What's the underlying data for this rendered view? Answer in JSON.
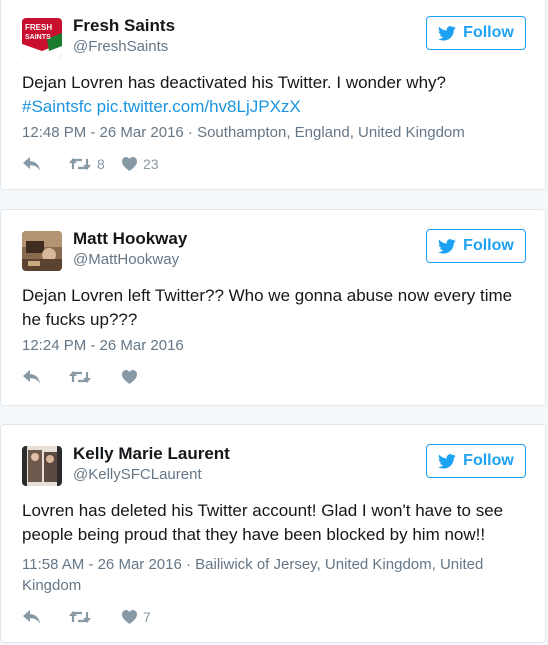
{
  "colors": {
    "accent": "#1da1f2",
    "link": "#1b95e0",
    "text": "#14171a",
    "muted": "#657786",
    "action": "#8899a6",
    "border": "#e1e8ed",
    "background": "#f5f8fa"
  },
  "tweets": [
    {
      "name": "Fresh Saints",
      "handle": "@FreshSaints",
      "avatar_text": "FRESH SAINTS",
      "follow_label": "Follow",
      "text": "Dejan Lovren has deactivated his Twitter. I wonder why?",
      "hashtag": "#Saintsfc",
      "link": "pic.twitter.com/hv8LjJPXzX",
      "meta": "12:48 PM - 26 Mar 2016 · Southampton, England, United Kingdom",
      "retweets": "8",
      "likes": "23",
      "icons": [
        "reply-icon",
        "retweet-icon",
        "heart-icon",
        "twitter-bird-icon"
      ]
    },
    {
      "name": "Matt Hookway",
      "handle": "@MattHookway",
      "follow_label": "Follow",
      "text": "Dejan Lovren left Twitter?? Who we gonna abuse now every time he fucks up???",
      "meta": "12:24 PM - 26 Mar 2016",
      "retweets": "",
      "likes": "",
      "icons": [
        "reply-icon",
        "retweet-icon",
        "heart-icon",
        "twitter-bird-icon"
      ]
    },
    {
      "name": "Kelly Marie Laurent",
      "handle": "@KellySFCLaurent",
      "follow_label": "Follow",
      "text": "Lovren has deleted his Twitter account! Glad I won't have to see people being proud that they have been blocked by him now!!",
      "meta": "11:58 AM - 26 Mar 2016 · Bailiwick of Jersey, United Kingdom, United Kingdom",
      "retweets": "",
      "likes": "7",
      "icons": [
        "reply-icon",
        "retweet-icon",
        "heart-icon",
        "twitter-bird-icon"
      ]
    }
  ]
}
